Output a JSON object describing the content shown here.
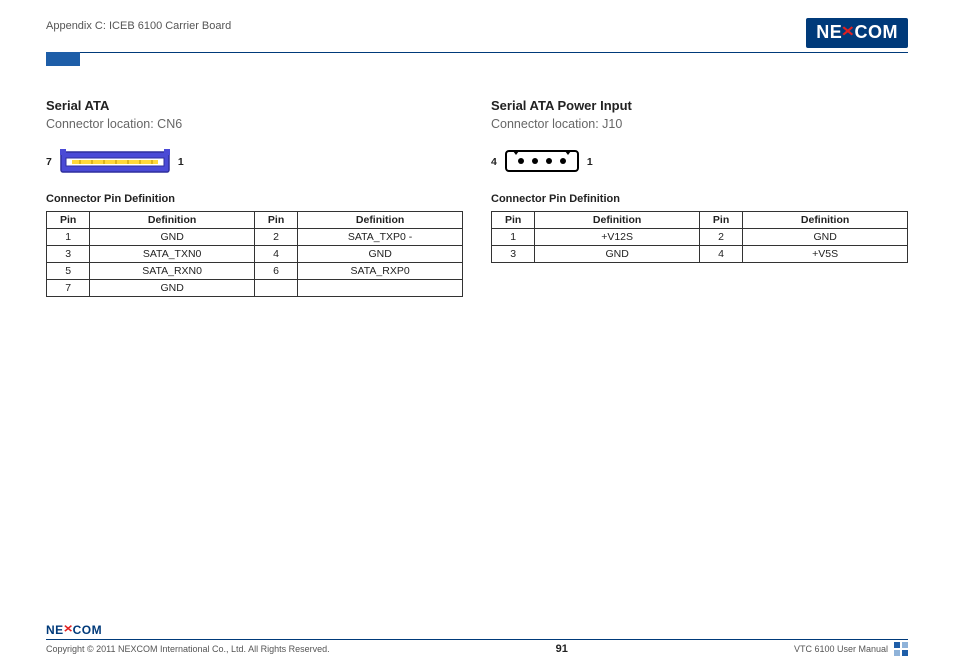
{
  "header": {
    "appendix": "Appendix C: ICEB 6100 Carrier Board",
    "logo_text_left": "NE",
    "logo_text_right": "COM"
  },
  "left": {
    "title": "Serial ATA",
    "subtitle": "Connector location: CN6",
    "label_left": "7",
    "label_right": "1",
    "table_title": "Connector Pin Definition",
    "headers": {
      "pin": "Pin",
      "def": "Definition"
    },
    "rows": [
      {
        "p1": "1",
        "d1": "GND",
        "p2": "2",
        "d2": "SATA_TXP0 -"
      },
      {
        "p1": "3",
        "d1": "SATA_TXN0",
        "p2": "4",
        "d2": "GND"
      },
      {
        "p1": "5",
        "d1": "SATA_RXN0",
        "p2": "6",
        "d2": "SATA_RXP0"
      },
      {
        "p1": "7",
        "d1": "GND",
        "p2": "",
        "d2": ""
      }
    ]
  },
  "right": {
    "title": "Serial ATA Power Input",
    "subtitle": "Connector location: J10",
    "label_left": "4",
    "label_right": "1",
    "table_title": "Connector Pin Definition",
    "headers": {
      "pin": "Pin",
      "def": "Definition"
    },
    "rows": [
      {
        "p1": "1",
        "d1": "+V12S",
        "p2": "2",
        "d2": "GND"
      },
      {
        "p1": "3",
        "d1": "GND",
        "p2": "4",
        "d2": "+V5S"
      }
    ]
  },
  "footer": {
    "logo_text_left": "NE",
    "logo_text_right": "COM",
    "copyright": "Copyright © 2011 NEXCOM International Co., Ltd. All Rights Reserved.",
    "page": "91",
    "manual": "VTC 6100 User Manual"
  }
}
